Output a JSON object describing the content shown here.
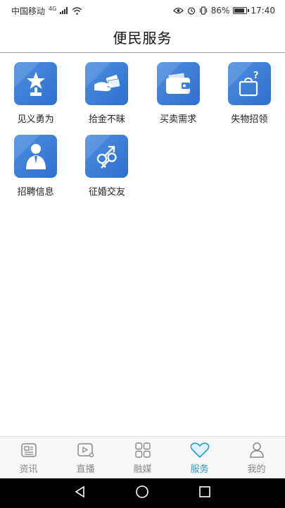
{
  "status_bar": {
    "carrier": "中国移动",
    "network": "4G",
    "battery": "86%",
    "battery_level": 0.86,
    "time": "17:40"
  },
  "header": {
    "title": "便民服务"
  },
  "services": [
    {
      "label": "见义勇为",
      "icon": "trophy-star-icon"
    },
    {
      "label": "拾金不昧",
      "icon": "hand-money-icon"
    },
    {
      "label": "买卖需求",
      "icon": "wallet-icon"
    },
    {
      "label": "失物招领",
      "icon": "lost-bag-icon"
    },
    {
      "label": "招聘信息",
      "icon": "person-suit-icon"
    },
    {
      "label": "征婚交友",
      "icon": "gender-symbols-icon"
    }
  ],
  "bottom_nav": [
    {
      "label": "资讯",
      "icon": "news-icon",
      "active": false
    },
    {
      "label": "直播",
      "icon": "live-video-icon",
      "active": false
    },
    {
      "label": "融媒",
      "icon": "grid-apps-icon",
      "active": false
    },
    {
      "label": "服务",
      "icon": "heart-icon",
      "active": true
    },
    {
      "label": "我的",
      "icon": "person-icon",
      "active": false
    }
  ],
  "colors": {
    "icon_bg": "#3d7fd9",
    "active_tab": "#2b9bd0",
    "inactive_tab": "#888888"
  }
}
